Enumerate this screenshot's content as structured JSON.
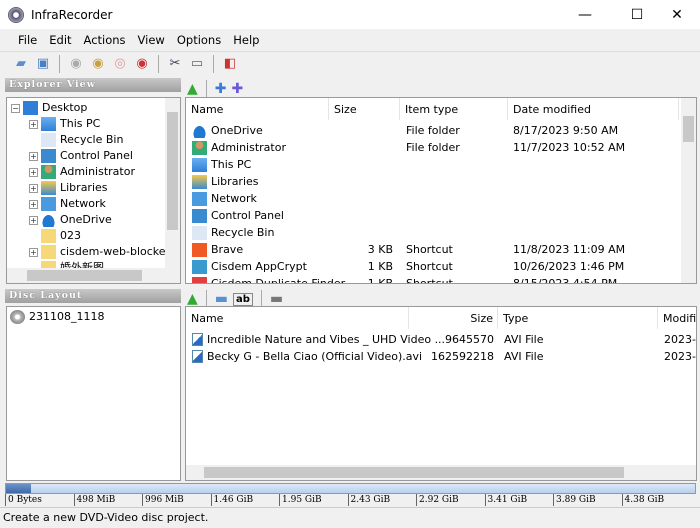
{
  "window": {
    "title": "InfraRecorder",
    "minimize": "—",
    "maximize": "☐",
    "close": "✕"
  },
  "menu": [
    "File",
    "Edit",
    "Actions",
    "View",
    "Options",
    "Help"
  ],
  "toolbar": [
    {
      "icon": "open-project-icon"
    },
    {
      "icon": "save-project-icon"
    },
    {
      "icon": "burn-image-icon"
    },
    {
      "icon": "burn-compilation-icon"
    },
    {
      "icon": "copy-disc-icon"
    },
    {
      "icon": "erase-disc-icon"
    },
    {
      "icon": "tools-icon"
    },
    {
      "icon": "disc-info-icon"
    },
    {
      "icon": "exit-icon"
    }
  ],
  "explorer": {
    "header": "Explorer View",
    "tree": [
      {
        "label": "Desktop",
        "level": 0,
        "exp": "−",
        "icon": "desktop"
      },
      {
        "label": "This PC",
        "level": 1,
        "exp": "+",
        "icon": "pc"
      },
      {
        "label": "Recycle Bin",
        "level": 1,
        "exp": "",
        "icon": "bin"
      },
      {
        "label": "Control Panel",
        "level": 1,
        "exp": "+",
        "icon": "cp"
      },
      {
        "label": "Administrator",
        "level": 1,
        "exp": "+",
        "icon": "user"
      },
      {
        "label": "Libraries",
        "level": 1,
        "exp": "+",
        "icon": "lib"
      },
      {
        "label": "Network",
        "level": 1,
        "exp": "+",
        "icon": "net"
      },
      {
        "label": "OneDrive",
        "level": 1,
        "exp": "+",
        "icon": "cloud"
      },
      {
        "label": "023",
        "level": 1,
        "exp": "",
        "icon": "folder"
      },
      {
        "label": "cisdem-web-blocker-",
        "level": 1,
        "exp": "+",
        "icon": "folder"
      },
      {
        "label": "婚外新图",
        "level": 1,
        "exp": "",
        "icon": "folder"
      }
    ],
    "columns": [
      "Name",
      "Size",
      "Item type",
      "Date modified"
    ],
    "rows": [
      [
        "OneDrive",
        "",
        "File folder",
        "8/17/2023 9:50 AM",
        "cloud"
      ],
      [
        "Administrator",
        "",
        "File folder",
        "11/7/2023 10:52 AM",
        "user"
      ],
      [
        "This PC",
        "",
        "",
        "",
        "pc"
      ],
      [
        "Libraries",
        "",
        "",
        "",
        "lib"
      ],
      [
        "Network",
        "",
        "",
        "",
        "net"
      ],
      [
        "Control Panel",
        "",
        "",
        "",
        "cp"
      ],
      [
        "Recycle Bin",
        "",
        "",
        "",
        "bin"
      ],
      [
        "Brave",
        "3 KB",
        "Shortcut",
        "11/8/2023 11:09 AM",
        "brave"
      ],
      [
        "Cisdem AppCrypt",
        "1 KB",
        "Shortcut",
        "10/26/2023 1:46 PM",
        "lock"
      ],
      [
        "Cisdem Duplicate Finder",
        "1 KB",
        "Shortcut",
        "8/15/2023 4:54 PM",
        "dup"
      ]
    ]
  },
  "disc": {
    "header": "Disc Layout",
    "root": "231108_1118",
    "columns": [
      "Name",
      "Size",
      "Type",
      "Modifi"
    ],
    "rows": [
      [
        "Incredible Nature and Vibes _ UHD Video ...",
        "9645570",
        "AVI File",
        "2023-1"
      ],
      [
        "Becky G - Bella Ciao (Official Video).avi",
        "162592218",
        "AVI File",
        "2023-1"
      ]
    ]
  },
  "capacity": {
    "used_percent": 3.7,
    "ticks": [
      "0 Bytes",
      "498 MiB",
      "996 MiB",
      "1.46 GiB",
      "1.95 GiB",
      "2.43 GiB",
      "2.92 GiB",
      "3.41 GiB",
      "3.89 GiB",
      "4.38 GiB"
    ]
  },
  "status": "Create a new DVD-Video disc project.",
  "colors": {
    "accent": "#3d6aa8",
    "header_gray": "#a0a0a0"
  }
}
